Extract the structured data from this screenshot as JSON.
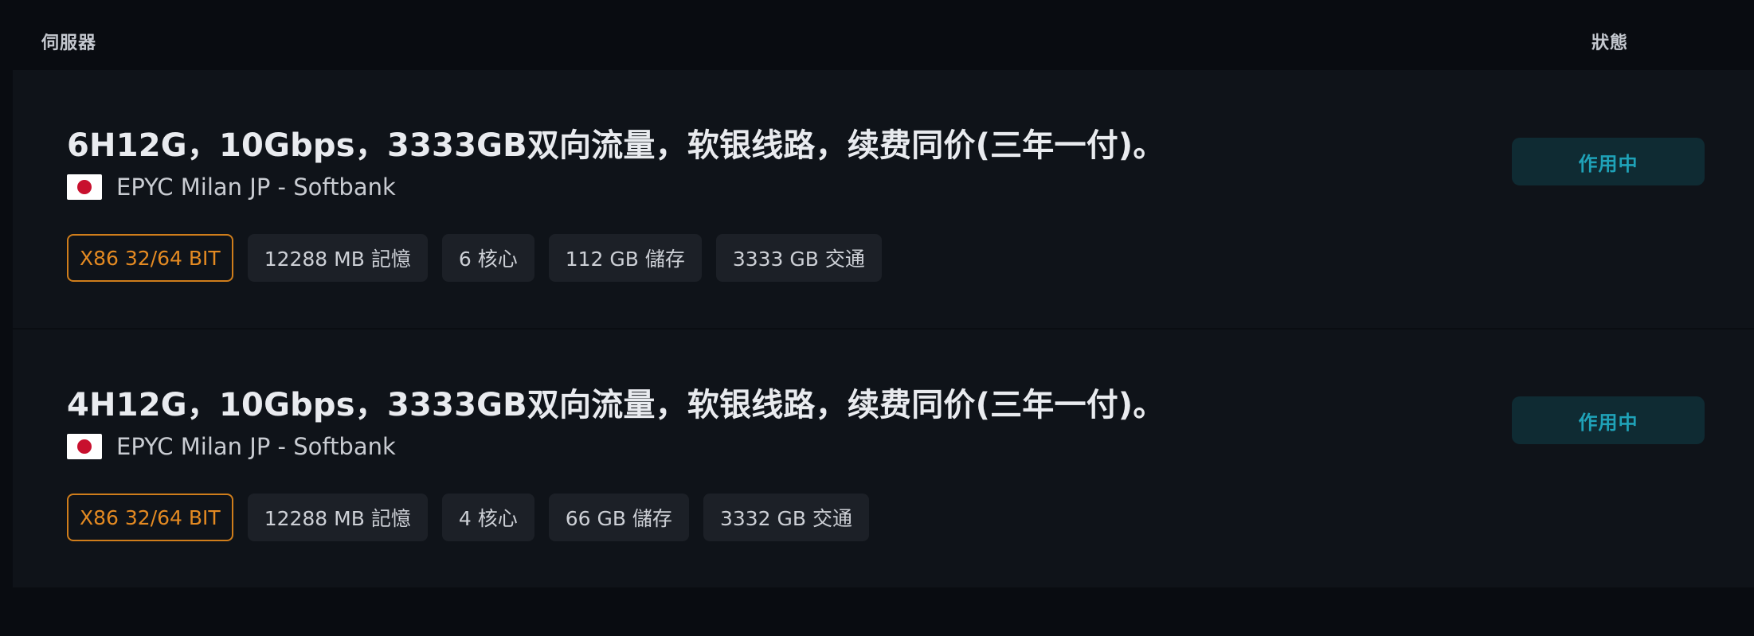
{
  "header": {
    "server_label": "伺服器",
    "status_label": "狀態"
  },
  "servers": [
    {
      "title": "6H12G，10Gbps，3333GB双向流量，软银线路，续费同价(三年一付)。",
      "location": "EPYC Milan JP - Softbank",
      "flag_icon": "japan-flag-icon",
      "specs": {
        "arch": "X86 32/64 BIT",
        "memory": "12288 MB 記憶",
        "cores": "6 核心",
        "storage": "112 GB 儲存",
        "traffic": "3333 GB 交通"
      },
      "status": "作用中"
    },
    {
      "title": "4H12G，10Gbps，3333GB双向流量，软银线路，续费同价(三年一付)。",
      "location": "EPYC Milan JP - Softbank",
      "flag_icon": "japan-flag-icon",
      "specs": {
        "arch": "X86 32/64 BIT",
        "memory": "12288 MB 記憶",
        "cores": "4 核心",
        "storage": "66 GB 儲存",
        "traffic": "3332 GB 交通"
      },
      "status": "作用中"
    }
  ],
  "colors": {
    "background": "#090c11",
    "card_background": "#0f1319",
    "arch_accent": "#e48a22",
    "status_accent": "#1fa2b8",
    "status_background": "#0f2b33",
    "spec_background": "#1c2027"
  }
}
